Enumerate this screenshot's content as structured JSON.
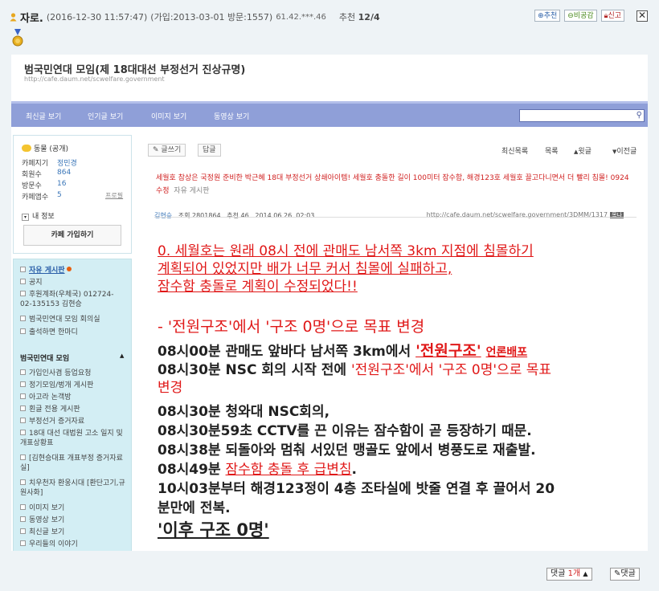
{
  "header": {
    "author": "자로.",
    "datetime": "(2016-12-30 11:57:47)",
    "joined": "(가입:2013-03-01 방문:1557)",
    "ip": "61.42.***.46",
    "recommend_label": "추천",
    "recommend_value": "12/4"
  },
  "actions": {
    "recommend": "추천",
    "unrecommend": "비공감",
    "report": "신고",
    "close": "✕"
  },
  "cafe": {
    "title": "범국민연대 모임(제 18대대선 부정선거 진상규명)",
    "url": "http://cafe.daum.net/scwelfare.government",
    "nav": [
      "최신글 보기",
      "인기글 보기",
      "이미지 보기",
      "동영상 보기"
    ],
    "search_icon": "search-icon"
  },
  "profile": {
    "level": "동물 (공개)",
    "rows": [
      {
        "k": "카페지기",
        "v": "정민경"
      },
      {
        "k": "회원수",
        "v": "864"
      },
      {
        "k": "방문수",
        "v": "16"
      },
      {
        "k": "카페앱수",
        "v": "5",
        "extra": "프로필"
      }
    ],
    "my_info": "내 정보",
    "join": "카페 가입하기"
  },
  "menu": {
    "top": [
      "자유 게시판",
      "공지",
      "후원계좌(우체국) 012724-02-135153 김현승",
      "범국민연대 모임 회의실",
      "출석하면 한마디"
    ],
    "section": "범국민연대 모임",
    "items": [
      "가입인사겸 등업요청",
      "정기모임/벙개 게시판",
      "아고라 논객방",
      "횐글 전용 게시판",
      "부정선거 증거자료",
      "18대 대선 대법원 고소 일지 및 개표상황표",
      "[김현승대표 개표부정 증거자료실]",
      "치우천자 환웅시대 [환단고기,규원사화]",
      "이미지 보기",
      "동영상 보기",
      "최신글 보기",
      "우리들의 이야기"
    ]
  },
  "article": {
    "write": "글쓰기",
    "reply": "답글",
    "right_nav": [
      "최신목록",
      "목록",
      "윗글",
      "이전글"
    ],
    "title": "세월호 참상은 국정원 준비한 박근혜 18대 부정선거 상쇄아이템! 세월호 충돌한 길이 100미터 잠수함, 해경123호 세월호 끌고다니면서 더 빨리 침몰! 0924수정",
    "category": "자유 게시판",
    "author": "김현승",
    "views": "조회 2801864",
    "recs": "추천 46",
    "date": "2014.06.26. 02:03",
    "url": "http://cafe.daum.net/scwelfare.government/3DMM/1317",
    "badge": "목나",
    "body": {
      "l1": "0. 세월호는 원래 08시 전에 관매도 남서쪽 3km 지점에 침몰하기",
      "l2": "계획되어 있었지만 배가 너무 커서 침몰에 실패하고,",
      "l3": "잠수함 충돌로 계획이 수정되었다!!",
      "l4": "- '전원구조'에서 '구조 0명'으로 목표 변경",
      "l5a": "08시00분 관매도 앞바다 남서쪽 3km에서",
      "l5b": "'전원구조'",
      "l5c": "언론배포",
      "l6a": "08시30분 NSC 회의 시작 전에",
      "l6b": "'전원구조'에서 '구조 0명'으로 목표",
      "l7": "변경",
      "l8": "08시30분 청와대 NSC회의,",
      "l9": "08시30분59초 CCTV를 끈 이유는 잠수함이 곧 등장하기 때문.",
      "l10": "08시38분 되돌아와 멈춰 서있던 맹골도 앞에서 병풍도로 재출발.",
      "l11a": "08시49분",
      "l11b": "잠수함 충돌 후 급변침",
      "l11c": ".",
      "l12": "10시03분부터 해경123정이 4층 조타실에 밧줄 연결 후 끌어서 20",
      "l13": "분만에 전복.",
      "l14": "'이후 구조 0명'"
    }
  },
  "comments": {
    "label": "댓글",
    "count": "1개",
    "write": "댓글"
  },
  "colors": {
    "nav_bg": "#8f9fd8",
    "side_menu_bg": "#d3eef4",
    "accent_red": "#e01818",
    "link_blue": "#3a76b8"
  }
}
